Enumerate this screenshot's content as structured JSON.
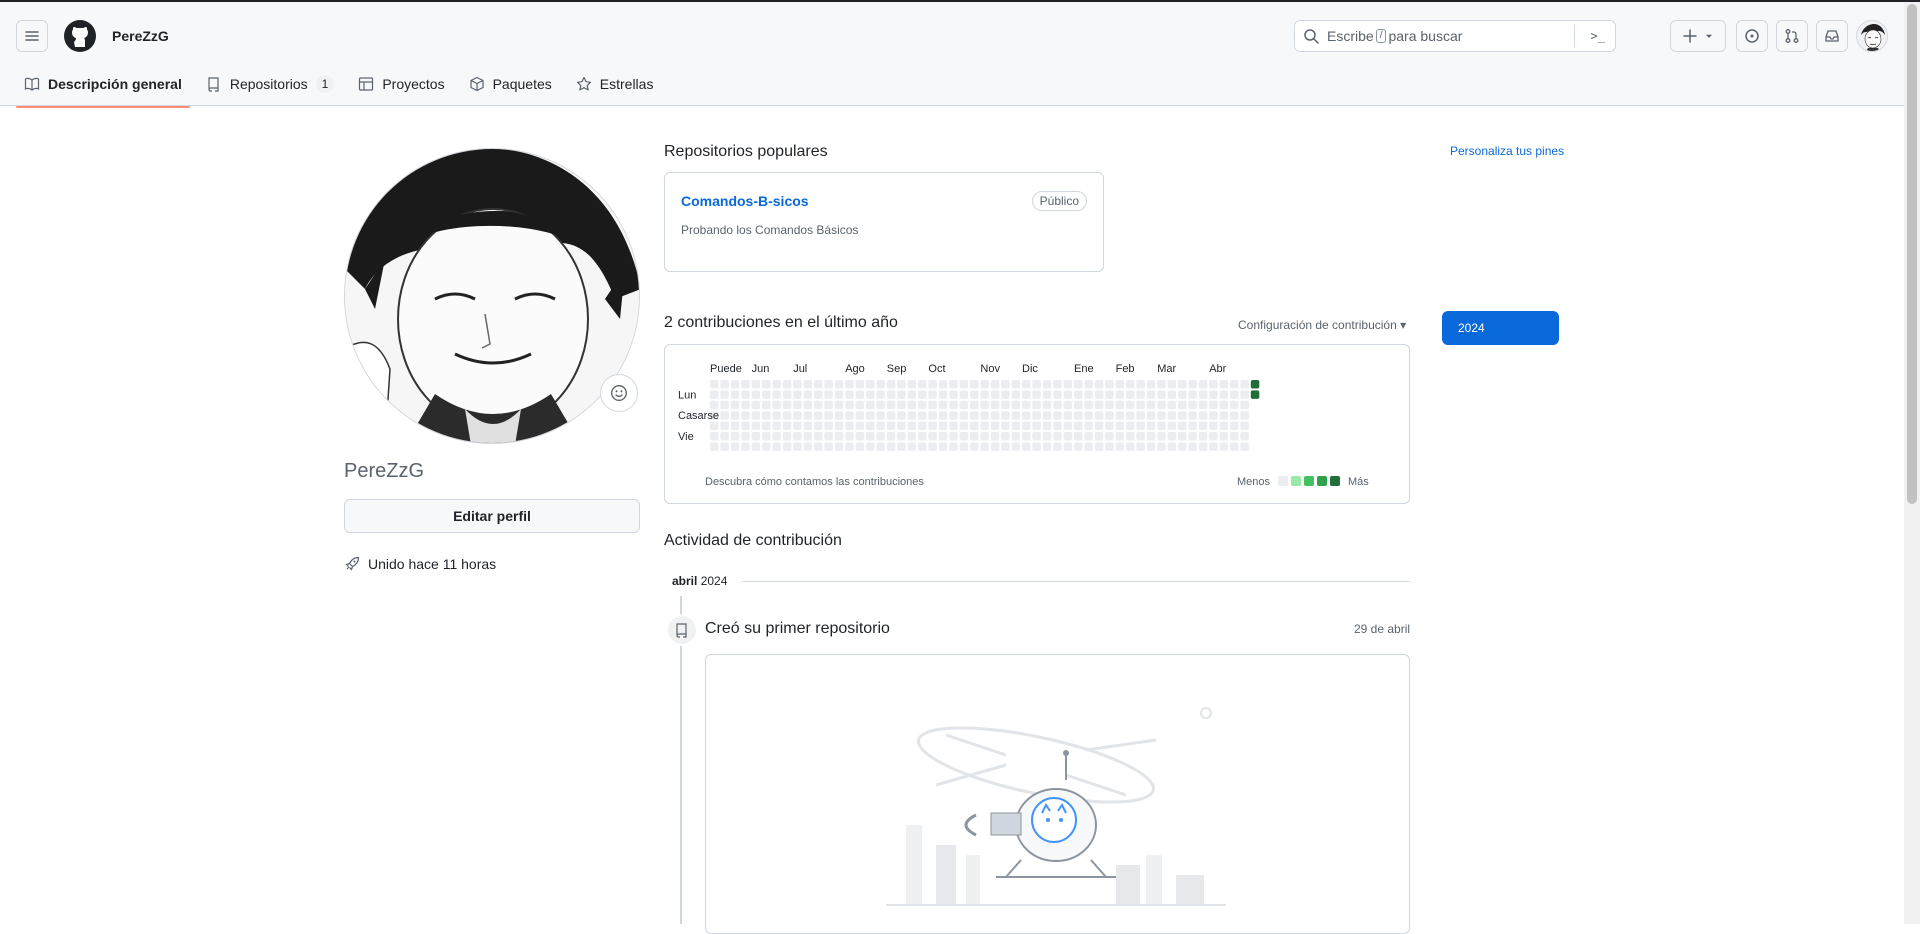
{
  "header": {
    "username": "PereZzG",
    "search": {
      "prefix": "Escribe",
      "key": "/",
      "suffix": "para buscar",
      "command_glyph": ">_"
    },
    "actions": [
      "plus-icon",
      "issue-icon",
      "pull-request-icon",
      "inbox-icon",
      "avatar"
    ]
  },
  "tabs": [
    {
      "label": "Descripción general",
      "icon": "book-icon",
      "active": true
    },
    {
      "label": "Repositorios",
      "icon": "repo-icon",
      "count": "1"
    },
    {
      "label": "Proyectos",
      "icon": "table-icon"
    },
    {
      "label": "Paquetes",
      "icon": "package-icon"
    },
    {
      "label": "Estrellas",
      "icon": "star-icon"
    }
  ],
  "profile": {
    "username": "PereZzG",
    "edit_label": "Editar perfil",
    "joined": "Unido hace 11 horas"
  },
  "popular": {
    "title": "Repositorios populares",
    "customize_link": "Personaliza tus pines",
    "repo": {
      "name": "Comandos-B-sicos",
      "visibility": "Público",
      "description": "Probando los Comandos Básicos"
    }
  },
  "contributions": {
    "title": "2 contribuciones en el último año",
    "settings": "Configuración de contribución",
    "months": [
      "Puede",
      "Jun",
      "Jul",
      "Ago",
      "Sep",
      "Oct",
      "Nov",
      "Dic",
      "Ene",
      "Feb",
      "Mar",
      "Abr"
    ],
    "days": [
      "Lun",
      "Casarse",
      "Vie"
    ],
    "footer_link": "Descubra cómo contamos las contribuciones",
    "legend_less": "Menos",
    "legend_more": "Más",
    "year": "2024",
    "weeks": 53,
    "active_cells": [
      {
        "week": 52,
        "day": 0
      },
      {
        "week": 52,
        "day": 1
      }
    ],
    "colors": {
      "empty": "#ebedf0",
      "level1": "#9be9a8",
      "level2": "#40c463",
      "level3": "#30a14e",
      "level4": "#216e39"
    }
  },
  "activity": {
    "title": "Actividad de contribución",
    "month_bold": "abril",
    "year": "2024",
    "event_title": "Creó su primer repositorio",
    "event_date": "29 de abril"
  }
}
